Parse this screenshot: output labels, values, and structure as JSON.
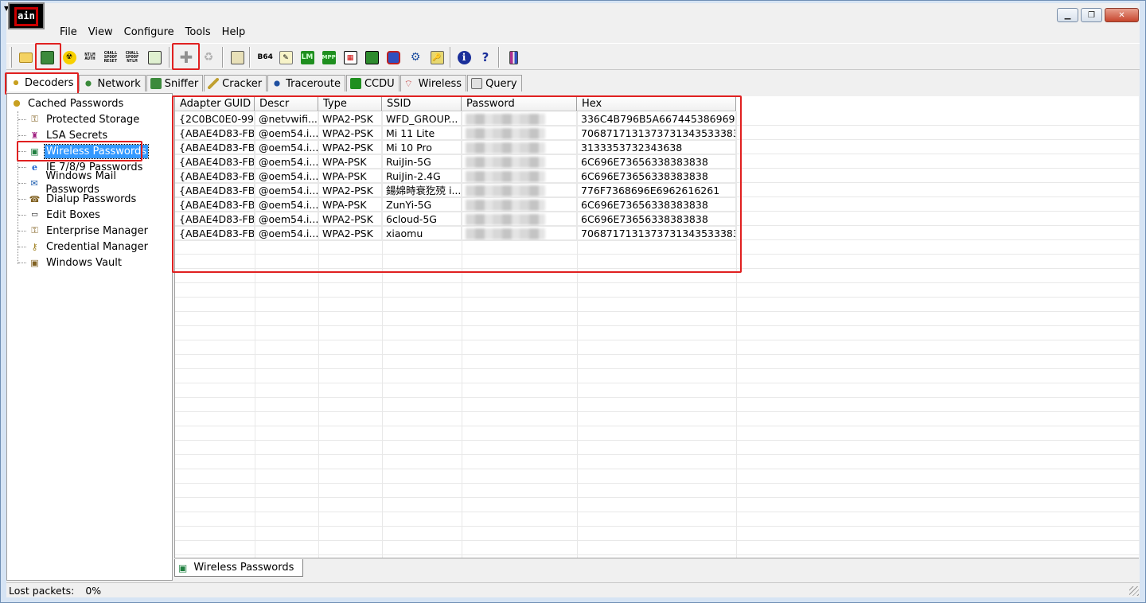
{
  "app": {
    "icon_text": "ain"
  },
  "menu": [
    "File",
    "View",
    "Configure",
    "Tools",
    "Help"
  ],
  "toolbar": {
    "ntlm_auth": "NTLM AUTH",
    "chall_reset": "CHALL SPOOF RESET",
    "chall_ntlm": "CHALL SPOOF NTLM",
    "b64": "B64",
    "lm_label": "LM",
    "mpp_label": "MPP"
  },
  "tabs": [
    {
      "label": "Decoders",
      "icon": "decoders-icon"
    },
    {
      "label": "Network",
      "icon": "network-icon"
    },
    {
      "label": "Sniffer",
      "icon": "sniffer-icon"
    },
    {
      "label": "Cracker",
      "icon": "cracker-icon"
    },
    {
      "label": "Traceroute",
      "icon": "traceroute-icon"
    },
    {
      "label": "CCDU",
      "icon": "ccdu-icon"
    },
    {
      "label": "Wireless",
      "icon": "wireless-icon"
    },
    {
      "label": "Query",
      "icon": "query-icon"
    }
  ],
  "tree": {
    "root": "Cached Passwords",
    "items": [
      "Protected Storage",
      "LSA Secrets",
      "Wireless Passwords",
      "IE 7/8/9 Passwords",
      "Windows Mail Passwords",
      "Dialup Passwords",
      "Edit Boxes",
      "Enterprise Manager",
      "Credential Manager",
      "Windows Vault"
    ]
  },
  "table": {
    "columns": [
      "Adapter GUID",
      "Descr",
      "Type",
      "SSID",
      "Password",
      "Hex"
    ],
    "rows": [
      [
        "{2C0BC0E0-99...",
        "@netvwifi...",
        "WPA2-PSK",
        "WFD_GROUP...",
        "",
        "336C4B796B5A6674453869694..."
      ],
      [
        "{ABAE4D83-FB...",
        "@oem54.i...",
        "WPA2-PSK",
        "Mi 11 Lite",
        "",
        "7068717131373731343533383..."
      ],
      [
        "{ABAE4D83-FB...",
        "@oem54.i...",
        "WPA2-PSK",
        "Mi 10 Pro",
        "",
        "3133353732343638"
      ],
      [
        "{ABAE4D83-FB...",
        "@oem54.i...",
        "WPA-PSK",
        "RuiJin-5G",
        "",
        "6C696E73656338383838"
      ],
      [
        "{ABAE4D83-FB...",
        "@oem54.i...",
        "WPA-PSK",
        "RuiJin-2.4G",
        "",
        "6C696E73656338383838"
      ],
      [
        "{ABAE4D83-FB...",
        "@oem54.i...",
        "WPA2-PSK",
        "鍚婂時衰犵殑 i...",
        "",
        "776F7368696E6962616261"
      ],
      [
        "{ABAE4D83-FB...",
        "@oem54.i...",
        "WPA-PSK",
        "ZunYi-5G",
        "",
        "6C696E73656338383838"
      ],
      [
        "{ABAE4D83-FB...",
        "@oem54.i...",
        "WPA2-PSK",
        "6cloud-5G",
        "",
        "6C696E73656338383838"
      ],
      [
        "{ABAE4D83-FB...",
        "@oem54.i...",
        "WPA2-PSK",
        "xiaomu",
        "",
        "7068717131373731343533383..."
      ]
    ]
  },
  "bottom_tab": {
    "label": "Wireless Passwords"
  },
  "status": {
    "label": "Lost packets:",
    "value": "0%"
  },
  "colors": {
    "highlight": "#e02020",
    "selection": "#3399ff"
  }
}
